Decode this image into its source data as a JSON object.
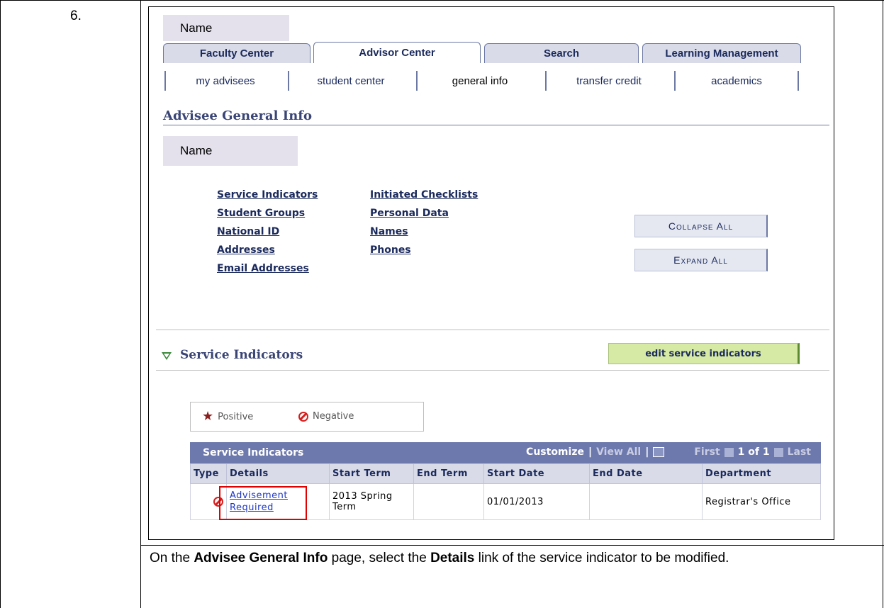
{
  "step": {
    "number": "6."
  },
  "instruction": {
    "prefix": "On the ",
    "page_name": "Advisee General Info",
    "middle": " page, select the ",
    "link_name": "Details",
    "suffix": " link of the service indicator to be modified."
  },
  "screenshot": {
    "name_label_top": "Name",
    "tabs": [
      {
        "label": "Faculty Center",
        "active": false
      },
      {
        "label": "Advisor Center",
        "active": true
      },
      {
        "label": "Search",
        "active": false
      },
      {
        "label": "Learning Management",
        "active": false
      }
    ],
    "subtabs": [
      {
        "label": "my advisees",
        "active": false
      },
      {
        "label": "student center",
        "active": false
      },
      {
        "label": "general info",
        "active": true
      },
      {
        "label": "transfer credit",
        "active": false
      },
      {
        "label": "academics",
        "active": false
      }
    ],
    "page_title": "Advisee General Info",
    "name_label": "Name",
    "page_links": [
      "Service Indicators",
      "Student Groups",
      "National ID",
      "Addresses",
      "Email Addresses",
      "Initiated Checklists",
      "Personal Data",
      "Names",
      "Phones"
    ],
    "collapse_all": "Collapse All",
    "expand_all": "Expand All",
    "section_title": "Service Indicators",
    "edit_button": "edit service indicators",
    "legend": {
      "positive": "Positive",
      "negative": "Negative"
    },
    "grid": {
      "title": "Service Indicators",
      "customize": "Customize",
      "sep1": "|",
      "view_all": "View All",
      "sep2": "|",
      "first": "First",
      "range": "1 of 1",
      "last": "Last",
      "columns": [
        "Type",
        "Details",
        "Start Term",
        "End Term",
        "Start Date",
        "End Date",
        "Department"
      ],
      "rows": [
        {
          "details_line1": "Advisement",
          "details_line2": "Required",
          "start_term": "2013 Spring Term",
          "end_term": "",
          "start_date": "01/01/2013",
          "end_date": "",
          "department": "Registrar's Office"
        }
      ]
    }
  },
  "colors": {
    "accent": "#6d78ad",
    "link": "#1f38c7",
    "highlight": "#e00000",
    "name_bg": "#e5e1ec"
  }
}
